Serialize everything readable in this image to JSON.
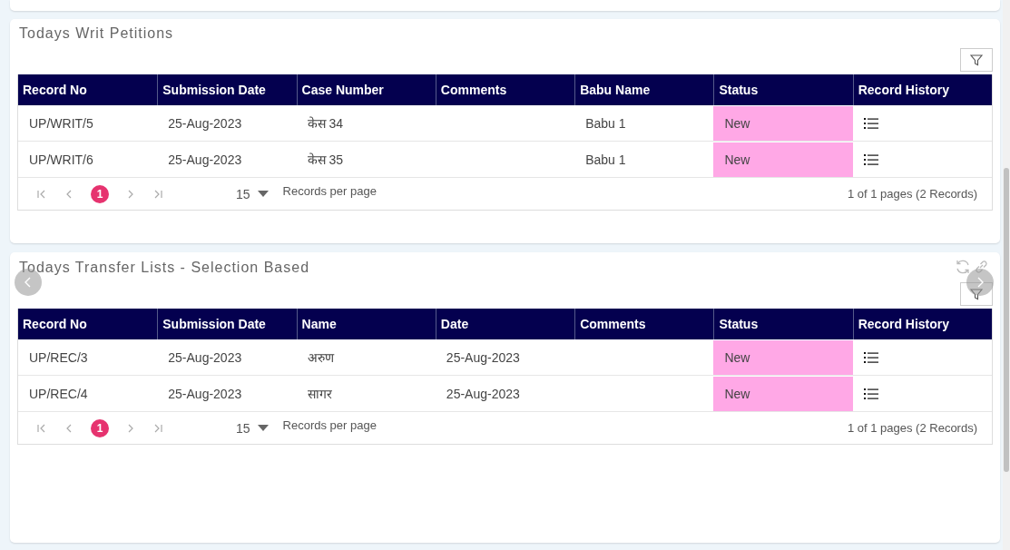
{
  "panels": [
    {
      "title": "Todays Writ Petitions",
      "kind": "plain",
      "columns": [
        {
          "label": "Record No",
          "kind": "text"
        },
        {
          "label": "Submission Date",
          "kind": "text"
        },
        {
          "label": "Case Number",
          "kind": "text"
        },
        {
          "label": "Comments",
          "kind": "text"
        },
        {
          "label": "Babu Name",
          "kind": "text"
        },
        {
          "label": "Status",
          "kind": "status"
        },
        {
          "label": "Record History",
          "kind": "history"
        }
      ],
      "rows": [
        {
          "cells": [
            "UP/WRIT/5",
            "25-Aug-2023",
            "केस 34",
            "",
            "Babu 1",
            "New",
            ""
          ]
        },
        {
          "cells": [
            "UP/WRIT/6",
            "25-Aug-2023",
            "केस 35",
            "",
            "Babu 1",
            "New",
            ""
          ]
        }
      ],
      "pager": {
        "page": "1",
        "per_page": "15",
        "per_page_label": "Records per page",
        "summary": "1 of 1 pages (2 Records)"
      }
    },
    {
      "title": "Todays Transfer Lists - Selection Based",
      "kind": "carousel",
      "columns": [
        {
          "label": "Record No",
          "kind": "text"
        },
        {
          "label": "Submission Date",
          "kind": "text"
        },
        {
          "label": "Name",
          "kind": "text"
        },
        {
          "label": "Date",
          "kind": "text"
        },
        {
          "label": "Comments",
          "kind": "text"
        },
        {
          "label": "Status",
          "kind": "status"
        },
        {
          "label": "Record History",
          "kind": "history"
        }
      ],
      "rows": [
        {
          "cells": [
            "UP/REC/3",
            "25-Aug-2023",
            "अरुण",
            "25-Aug-2023",
            "",
            "New",
            ""
          ]
        },
        {
          "cells": [
            "UP/REC/4",
            "25-Aug-2023",
            "सागर",
            "25-Aug-2023",
            "",
            "New",
            ""
          ]
        }
      ],
      "pager": {
        "page": "1",
        "per_page": "15",
        "per_page_label": "Records per page",
        "summary": "1 of 1 pages (2 Records)"
      }
    }
  ]
}
